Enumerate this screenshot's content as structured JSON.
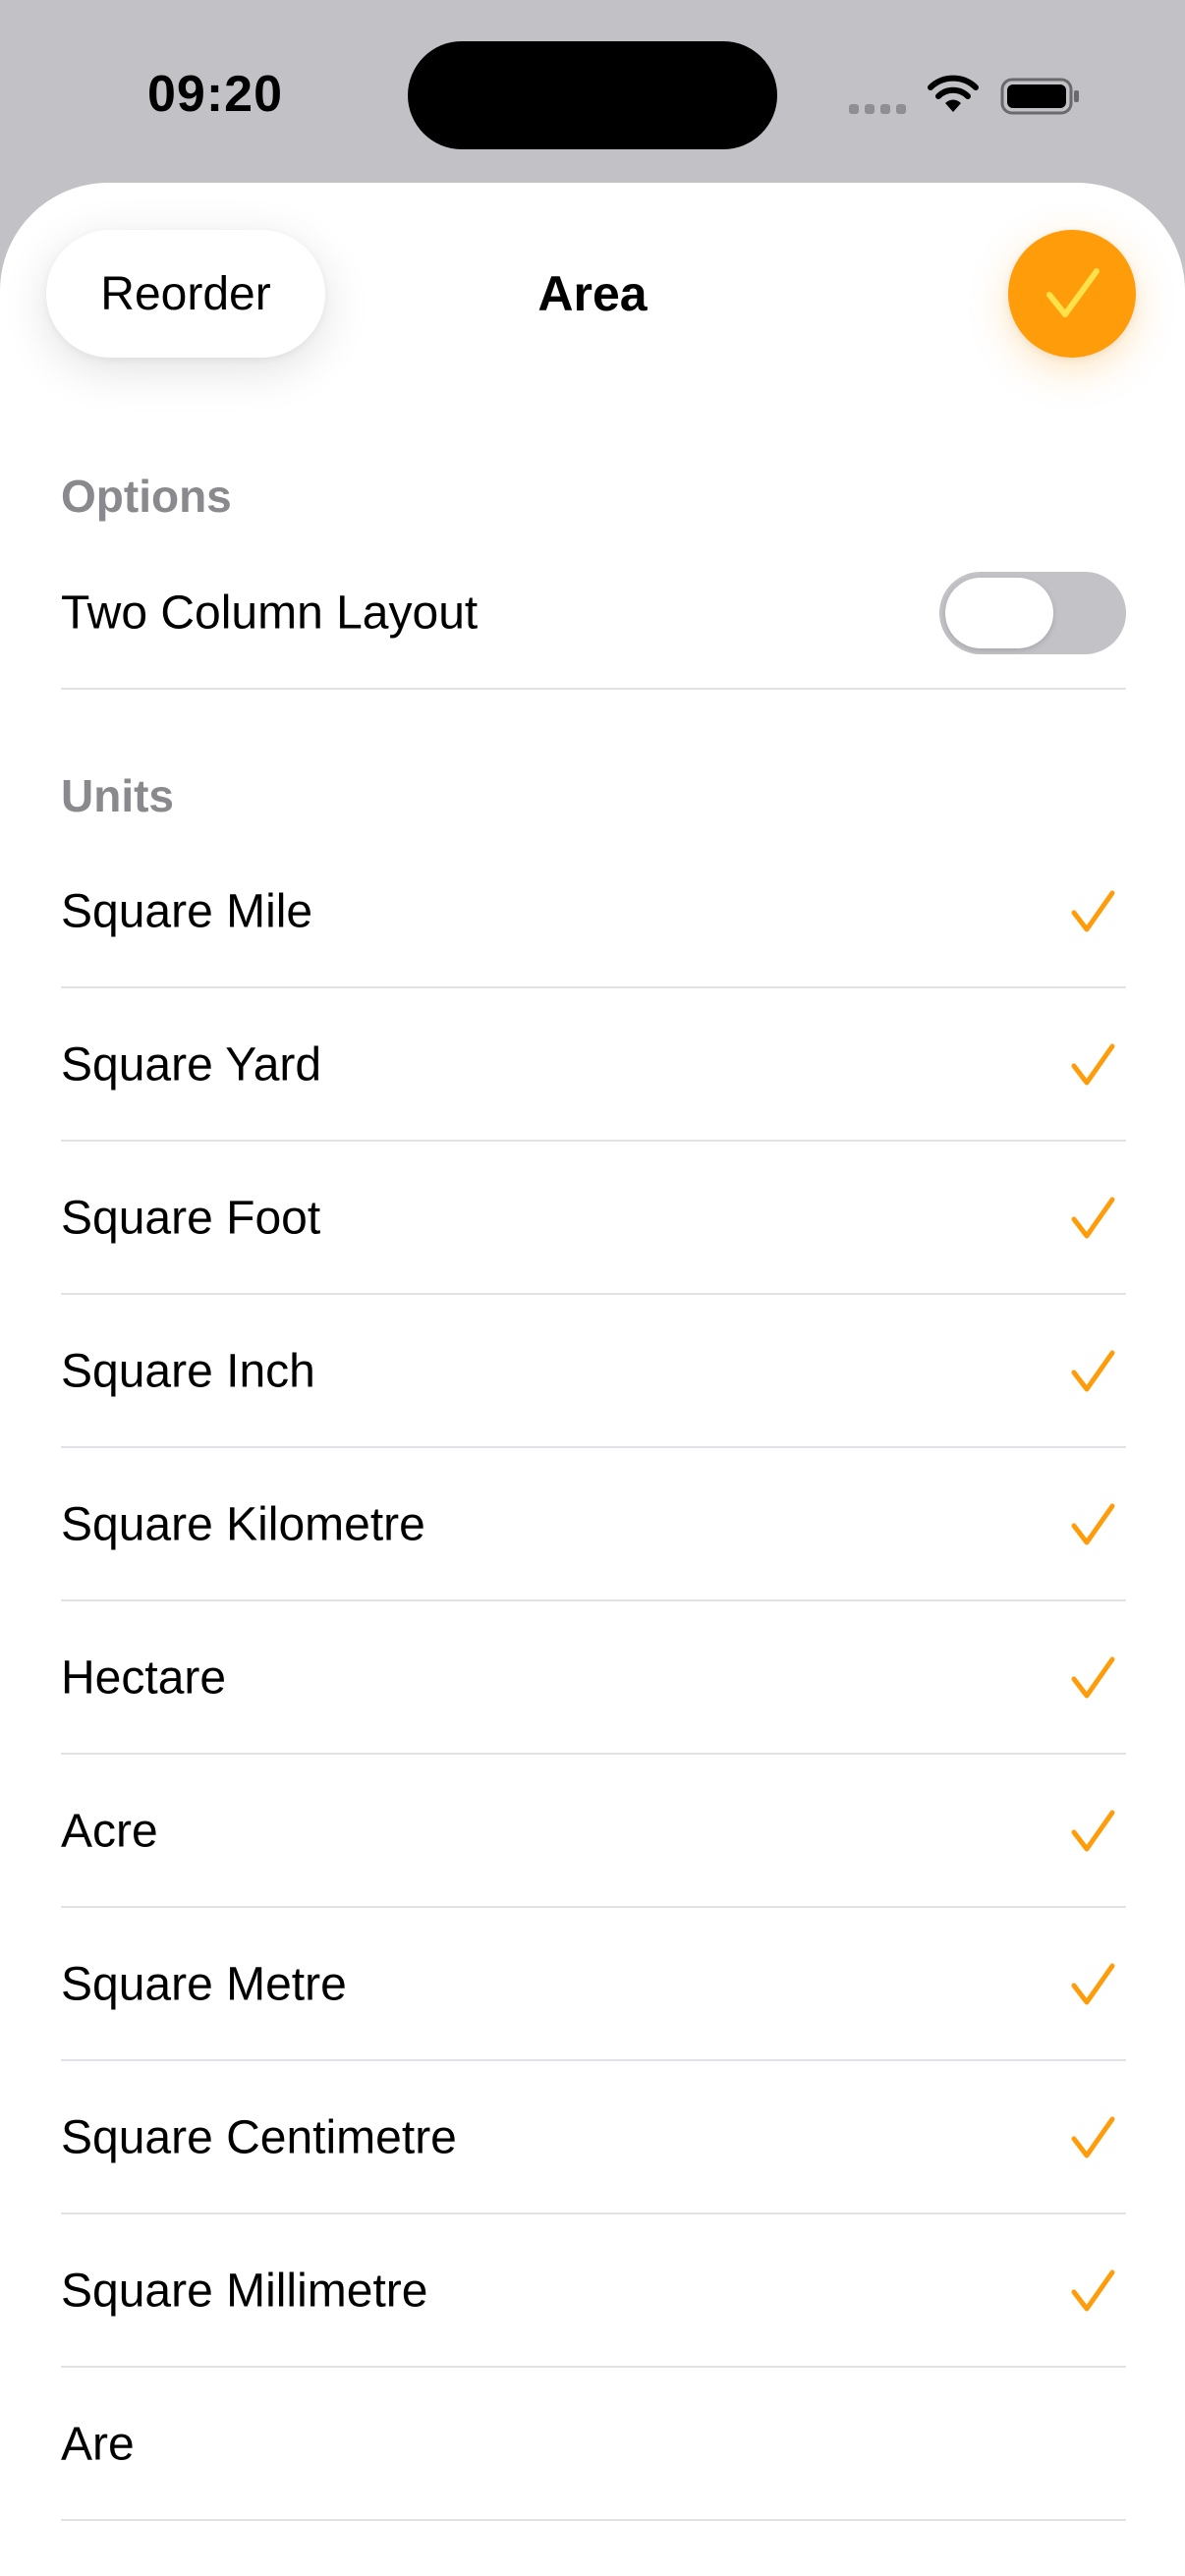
{
  "status_bar": {
    "time": "09:20"
  },
  "header": {
    "reorder_label": "Reorder",
    "title": "Area",
    "done_icon": "checkmark-icon"
  },
  "colors": {
    "accent": "#ff9c0a",
    "done_check": "#ffe14a",
    "secondary_text": "#8a8a8e",
    "toggle_off": "#c3c3c7"
  },
  "options": {
    "header": "Options",
    "two_column_layout": {
      "label": "Two Column Layout",
      "enabled": false
    }
  },
  "units": {
    "header": "Units",
    "items": [
      {
        "label": "Square Mile",
        "selected": true
      },
      {
        "label": "Square Yard",
        "selected": true
      },
      {
        "label": "Square Foot",
        "selected": true
      },
      {
        "label": "Square Inch",
        "selected": true
      },
      {
        "label": "Square Kilometre",
        "selected": true
      },
      {
        "label": "Hectare",
        "selected": true
      },
      {
        "label": "Acre",
        "selected": true
      },
      {
        "label": "Square Metre",
        "selected": true
      },
      {
        "label": "Square Centimetre",
        "selected": true
      },
      {
        "label": "Square Millimetre",
        "selected": true
      },
      {
        "label": "Are",
        "selected": false
      }
    ]
  }
}
